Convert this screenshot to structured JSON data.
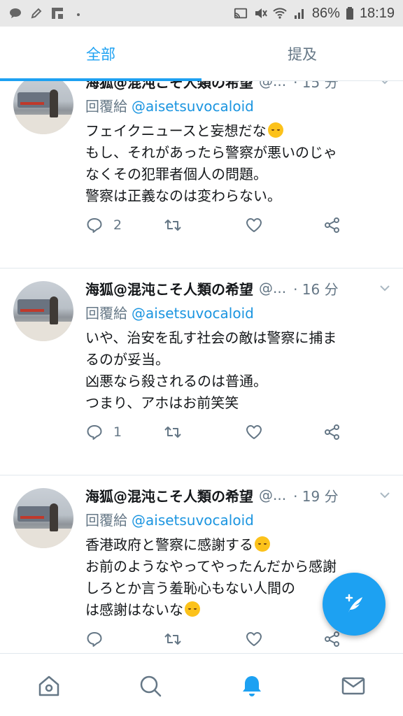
{
  "status_bar": {
    "battery": "86%",
    "time": "18:19",
    "left_icons": [
      "chat-bubble-icon",
      "pen-icon",
      "flipboard-icon",
      "dot-icon"
    ],
    "right_icons": [
      "cast-icon",
      "mute-icon",
      "wifi-icon",
      "signal-icon",
      "battery-icon"
    ]
  },
  "tabs": [
    {
      "label": "全部",
      "active": true
    },
    {
      "label": "提及",
      "active": false
    }
  ],
  "tweets": [
    {
      "display_name": "海狐@混沌こそ人類の希望",
      "handle": "@...",
      "time": "· 15 分",
      "reply_prefix": "回覆給",
      "reply_to": "@aisetsuvocaloid",
      "lines": [
        "フェイクニュースと妄想だな",
        "もし、それがあったら警察が悪いのじゃ",
        "なくその犯罪者個人の問題。",
        "警察は正義なのは変わらない。"
      ],
      "reply_count": "2"
    },
    {
      "display_name": "海狐@混沌こそ人類の希望",
      "handle": "@...",
      "time": "· 16 分",
      "reply_prefix": "回覆給",
      "reply_to": "@aisetsuvocaloid",
      "lines": [
        "いや、治安を乱す社会の敵は警察に捕ま",
        "るのが妥当。",
        "凶悪なら殺されるのは普通。",
        "つまり、アホはお前笑笑"
      ],
      "reply_count": "1"
    },
    {
      "display_name": "海狐@混沌こそ人類の希望",
      "handle": "@...",
      "time": "· 19 分",
      "reply_prefix": "回覆給",
      "reply_to": "@aisetsuvocaloid",
      "lines": [
        "香港政府と警察に感謝する",
        "お前のようなやってやったんだから感謝",
        "しろとか言う羞恥心もない人間の",
        "は感謝はないな"
      ],
      "reply_count": ""
    }
  ],
  "colors": {
    "accent": "#1da1f2",
    "mention": "#1b95e0",
    "muted": "#657786"
  },
  "bottom_nav": [
    "home-icon",
    "search-icon",
    "notifications-icon",
    "messages-icon"
  ]
}
